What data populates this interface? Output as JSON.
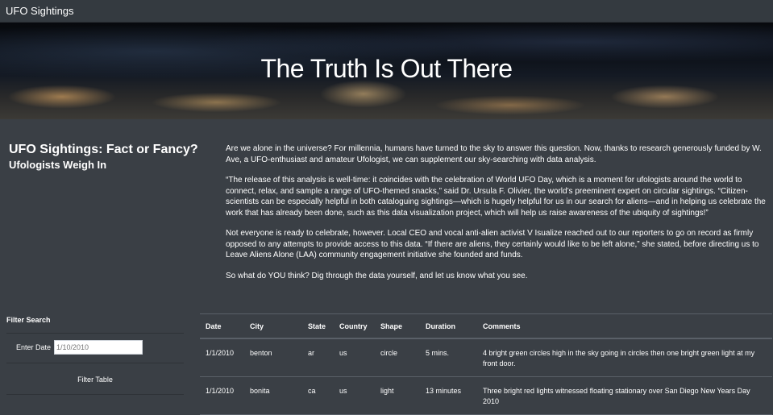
{
  "navbar": {
    "brand": "UFO Sightings"
  },
  "hero": {
    "title": "The Truth Is Out There"
  },
  "article": {
    "title": "UFO Sightings: Fact or Fancy?",
    "subtitle": "Ufologists Weigh In",
    "paragraphs": [
      "Are we alone in the universe? For millennia, humans have turned to the sky to answer this question. Now, thanks to research generously funded by W. Ave, a UFO-enthusiast and amateur Ufologist, we can supplement our sky-searching with data analysis.",
      "“The release of this analysis is well-time: it coincides with the celebration of World UFO Day, which is a moment for ufologists around the world to connect, relax, and sample a range of UFO-themed snacks,” said Dr. Ursula F. Olivier, the world’s preeminent expert on circular sightings. “Citizen-scientists can be especially helpful in both cataloguing sightings—which is hugely helpful for us in our search for aliens—and in helping us celebrate the work that has already been done, such as this data visualization project, which will help us raise awareness of the ubiquity of sightings!”",
      "Not everyone is ready to celebrate, however. Local CEO and vocal anti-alien activist V Isualize reached out to our reporters to go on record as firmly opposed to any attempts to provide access to this data. “If there are aliens, they certainly would like to be left alone,” she stated, before directing us to Leave Aliens Alone (LAA) community engagement initiative she founded and funds.",
      "So what do YOU think? Dig through the data yourself, and let us know what you see."
    ]
  },
  "filter": {
    "heading": "Filter Search",
    "date_label": "Enter Date",
    "date_placeholder": "1/10/2010",
    "button_label": "Filter Table"
  },
  "table": {
    "headers": [
      "Date",
      "City",
      "State",
      "Country",
      "Shape",
      "Duration",
      "Comments"
    ],
    "rows": [
      [
        "1/1/2010",
        "benton",
        "ar",
        "us",
        "circle",
        "5 mins.",
        "4 bright green circles high in the sky going in circles then one bright green light at my front door."
      ],
      [
        "1/1/2010",
        "bonita",
        "ca",
        "us",
        "light",
        "13 minutes",
        "Three bright red lights witnessed floating stationary over San Diego New Years Day 2010"
      ]
    ]
  }
}
